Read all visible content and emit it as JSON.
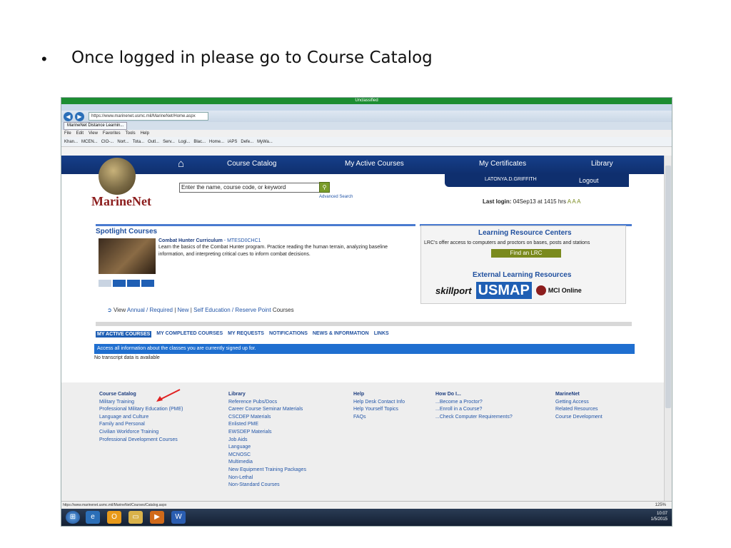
{
  "slide": {
    "bullet": "•",
    "text": "Once logged in please go to Course Catalog"
  },
  "browser": {
    "title": "Unclassified",
    "url": "https://www.marinenet.usmc.mil/MarineNet/Home.aspx",
    "tab_label": "MarineNet Distance Learnin...",
    "menu": [
      "File",
      "Edit",
      "View",
      "Favorites",
      "Tools",
      "Help"
    ],
    "favorites": [
      "Khan...",
      "MCEN...",
      "CIO-...",
      "Nort...",
      "Tota...",
      "Outl...",
      "Serv...",
      "Logi...",
      "Blac...",
      "Home...",
      "iAPS",
      "Defe...",
      "MyWa..."
    ],
    "status_url": "https://www.marinenet.usmc.mil/MarineNet/Courses/Catalog.aspx",
    "zoom": "125%"
  },
  "header": {
    "brand": "MarineNet",
    "nav": {
      "course_catalog": "Course Catalog",
      "my_active_courses": "My Active Courses",
      "my_certificates": "My Certificates",
      "library": "Library"
    },
    "user": "LATONYA.D.GRIFFITH",
    "logout": "Logout",
    "search_value": "Enter the name, course code, or keyword",
    "advanced_search": "Advanced Search",
    "last_login_label": "Last login:",
    "last_login_value": "04Sep13 at 1415 hrs",
    "font_sizes": "A A A"
  },
  "spotlight": {
    "title": "Spotlight Courses",
    "course_name": "Combat Hunter Curriculum",
    "course_code": "- MTESD0CHC1",
    "description": "Learn the basics of the Combat Hunter program. Practice reading the human terrain, analyzing baseline information, and interpreting critical cues to inform combat decisions."
  },
  "view_row": {
    "view": "View",
    "annual": "Annual / Required",
    "sep1": "|",
    "new": "New",
    "sep2": "|",
    "self_ed": "Self Education / Reserve Point",
    "courses": "Courses"
  },
  "lrc": {
    "title": "Learning Resource Centers",
    "description": "LRC's offer access to computers and proctors on bases, posts and stations",
    "button": "Find an LRC",
    "ext_title": "External Learning Resources",
    "skillport": "skillport",
    "usmap": "USMAP",
    "mci": "MCI Online"
  },
  "tabs": {
    "items": [
      "MY ACTIVE COURSES",
      "MY COMPLETED COURSES",
      "MY REQUESTS",
      "NOTIFICATIONS",
      "NEWS & INFORMATION",
      "LINKS"
    ],
    "info": "Access all information about the classes you are currently signed up for.",
    "empty": "No transcript data is available"
  },
  "footer": {
    "col1": [
      "Course Catalog",
      "Military Training",
      "Professional Military Education (PME)",
      "Language and Culture",
      "Family and Personal",
      "Civilian Workforce Training",
      "Professional Development Courses"
    ],
    "col2_head": "Library",
    "col2": [
      "Reference Pubs/Docs",
      "Career Course Seminar Materials",
      "CSCDEP Materials",
      "Enlisted PME",
      "EWSDEP Materials",
      "Job Aids",
      "Language",
      "MCNOSC",
      "Multimedia",
      "New Equipment Training Packages",
      "Non-Lethal",
      "Non-Standard Courses"
    ],
    "col3_head": "Help",
    "col3": [
      "Help Desk Contact Info",
      "Help Yourself Topics",
      "FAQs"
    ],
    "col4_head": "How Do I...",
    "col4": [
      "...Become a Proctor?",
      "...Enroll in a Course?",
      "...Check Computer Requirements?"
    ],
    "col5_head": "MarineNet",
    "col5": [
      "Getting Access",
      "Related Resources",
      "Course Development"
    ]
  },
  "taskbar": {
    "time": "10:07",
    "date": "1/5/2015"
  },
  "colors": {
    "nav_blue": "#163f8a",
    "link_blue": "#2356a8",
    "brand_red": "#8c1d1d",
    "annotation_arrow": "#e02020"
  }
}
